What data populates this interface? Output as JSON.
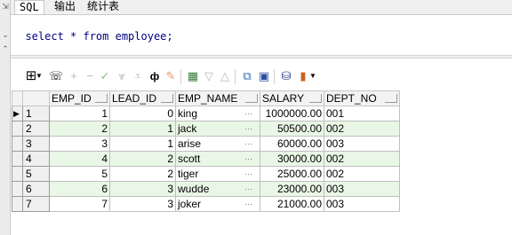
{
  "tabs": [
    {
      "label": "SQL",
      "active": true
    },
    {
      "label": "输出",
      "active": false
    },
    {
      "label": "统计表",
      "active": false
    }
  ],
  "editor": {
    "sql": "select * from employee;"
  },
  "toolbar": {
    "icons": [
      "grid-icon",
      "dropdown-arrow-icon",
      "lock-icon",
      "plus-icon",
      "minus-icon",
      "check-icon",
      "filter-down-icon",
      "filter-icon",
      "binoculars-icon",
      "eraser-icon",
      "table-query-icon",
      "chevron-down-icon",
      "chevron-up-icon",
      "chart-edit-icon",
      "save-icon",
      "database-icon",
      "bar-chart-icon",
      "dropdown-arrow-icon"
    ]
  },
  "grid": {
    "columns": [
      "EMP_ID",
      "LEAD_ID",
      "EMP_NAME",
      "SALARY",
      "DEPT_NO"
    ],
    "rows": [
      {
        "num": "1",
        "emp_id": "1",
        "lead_id": "0",
        "emp_name": "king",
        "salary": "1000000.00",
        "dept_no": "001"
      },
      {
        "num": "2",
        "emp_id": "2",
        "lead_id": "1",
        "emp_name": "jack",
        "salary": "50500.00",
        "dept_no": "002"
      },
      {
        "num": "3",
        "emp_id": "3",
        "lead_id": "1",
        "emp_name": "arise",
        "salary": "60000.00",
        "dept_no": "003"
      },
      {
        "num": "4",
        "emp_id": "4",
        "lead_id": "2",
        "emp_name": "scott",
        "salary": "30000.00",
        "dept_no": "002"
      },
      {
        "num": "5",
        "emp_id": "5",
        "lead_id": "2",
        "emp_name": "tiger",
        "salary": "25000.00",
        "dept_no": "002"
      },
      {
        "num": "6",
        "emp_id": "6",
        "lead_id": "3",
        "emp_name": "wudde",
        "salary": "23000.00",
        "dept_no": "003"
      },
      {
        "num": "7",
        "emp_id": "7",
        "lead_id": "3",
        "emp_name": "joker",
        "salary": "21000.00",
        "dept_no": "003"
      }
    ],
    "current_row_marker": "▶",
    "ellipsis": "···"
  },
  "colors": {
    "alt_row": "#e9f7e6",
    "sql_text": "#000080"
  }
}
